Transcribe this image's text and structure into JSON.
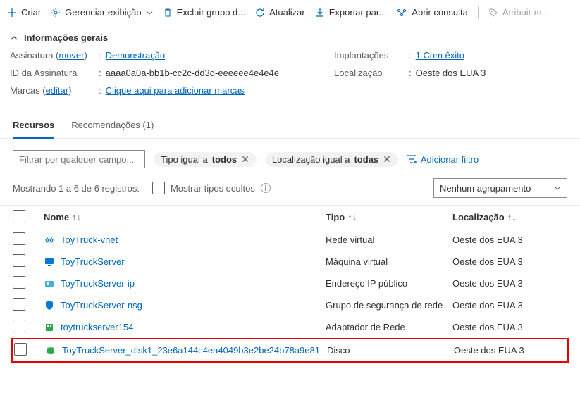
{
  "toolbar": {
    "create": "Criar",
    "manage_view": "Gerenciar exibição",
    "delete_group": "Excluir grupo d...",
    "refresh": "Atualizar",
    "export": "Exportar par...",
    "open_query": "Abrir consulta",
    "assign": "Atribuir m..."
  },
  "overview": {
    "header": "Informações gerais",
    "subscription_label_pre": "Assinatura (",
    "subscription_move": "mover",
    "subscription_label_post": ")",
    "subscription_value": "Demonstração",
    "sub_id_label": "ID da Assinatura",
    "sub_id_value": "aaaa0a0a-bb1b-cc2c-dd3d-eeeeee4e4e4e",
    "tags_label_pre": "Marcas (",
    "tags_edit": "editar",
    "tags_label_post": ")",
    "tags_value": "Clique aqui para adicionar marcas",
    "deployments_label": "Implantações",
    "deployments_value": "1 Com êxito",
    "location_label": "Localização",
    "location_value": "Oeste dos EUA 3"
  },
  "tabs": {
    "resources": "Recursos",
    "recommendations": "Recomendações (1)"
  },
  "filters": {
    "placeholder": "Filtrar por qualquer campo...",
    "type_pre": "Tipo igual a ",
    "type_val": "todos",
    "loc_pre": "Localização igual a ",
    "loc_val": "todas",
    "add": "Adicionar filtro"
  },
  "listing": {
    "count": "Mostrando 1 a 6 de 6 registros.",
    "show_hidden": "Mostrar tipos ocultos",
    "grouping": "Nenhum agrupamento"
  },
  "columns": {
    "name": "Nome",
    "type": "Tipo",
    "location": "Localização"
  },
  "rows": [
    {
      "name": "ToyTruck-vnet",
      "type": "Rede virtual",
      "location": "Oeste dos EUA 3",
      "icon": "vnet"
    },
    {
      "name": "ToyTruckServer",
      "type": "Máquina virtual",
      "location": "Oeste dos EUA 3",
      "icon": "vm"
    },
    {
      "name": "ToyTruckServer-ip",
      "type": "Endereço IP público",
      "location": "Oeste dos EUA 3",
      "icon": "ip"
    },
    {
      "name": "ToyTruckServer-nsg",
      "type": "Grupo de segurança de rede",
      "location": "Oeste dos EUA 3",
      "icon": "nsg"
    },
    {
      "name": "toytruckserver154",
      "type": "Adaptador de Rede",
      "location": "Oeste dos EUA 3",
      "icon": "nic"
    },
    {
      "name": "ToyTruckServer_disk1_23e6a144c4ea4049b3e2be24b78a9e81",
      "type": "Disco",
      "location": "Oeste dos EUA 3",
      "icon": "disk"
    }
  ]
}
